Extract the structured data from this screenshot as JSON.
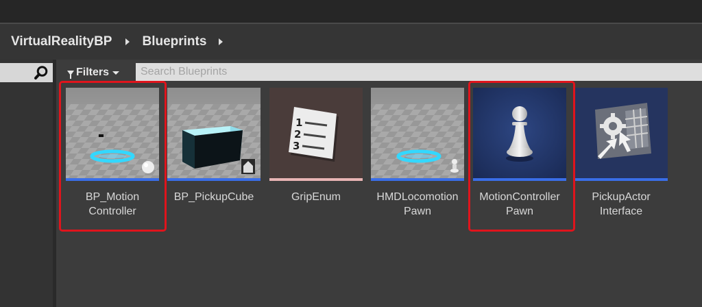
{
  "breadcrumb": {
    "root": "VirtualRealityBP",
    "folder": "Blueprints"
  },
  "filters": {
    "label": "Filters"
  },
  "search": {
    "placeholder": "Search Blueprints",
    "value": ""
  },
  "assets": [
    {
      "name_line1": "BP_Motion",
      "name_line2": "Controller",
      "type_color": "#3a6ee8",
      "highlighted": true
    },
    {
      "name_line1": "BP_PickupCube",
      "name_line2": "",
      "type_color": "#3a6ee8",
      "highlighted": false
    },
    {
      "name_line1": "GripEnum",
      "name_line2": "",
      "type_color": "#e8b4b4",
      "highlighted": false
    },
    {
      "name_line1": "HMDLocomotion",
      "name_line2": "Pawn",
      "type_color": "#3a6ee8",
      "highlighted": false
    },
    {
      "name_line1": "MotionController",
      "name_line2": "Pawn",
      "type_color": "#3a6ee8",
      "highlighted": true
    },
    {
      "name_line1": "PickupActor",
      "name_line2": "Interface",
      "type_color": "#3a6ee8",
      "highlighted": false
    }
  ],
  "colors": {
    "highlight": "#e0141c",
    "blueprint_underline": "#3a6ee8",
    "enum_underline": "#e8b4b4"
  }
}
